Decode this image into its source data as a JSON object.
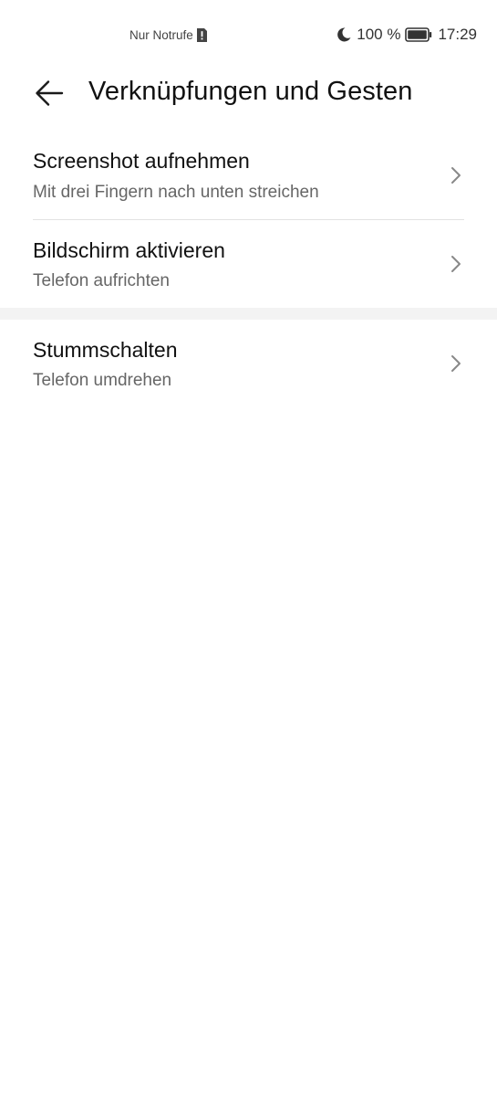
{
  "status_bar": {
    "carrier": "Nur Notrufe",
    "battery": "100 %",
    "time": "17:29"
  },
  "header": {
    "title": "Verknüpfungen und Gesten"
  },
  "items": [
    {
      "title": "Screenshot aufnehmen",
      "subtitle": "Mit drei Fingern nach unten streichen"
    },
    {
      "title": "Bildschirm aktivieren",
      "subtitle": "Telefon aufrichten"
    },
    {
      "title": "Stummschalten",
      "subtitle": "Telefon umdrehen"
    }
  ]
}
